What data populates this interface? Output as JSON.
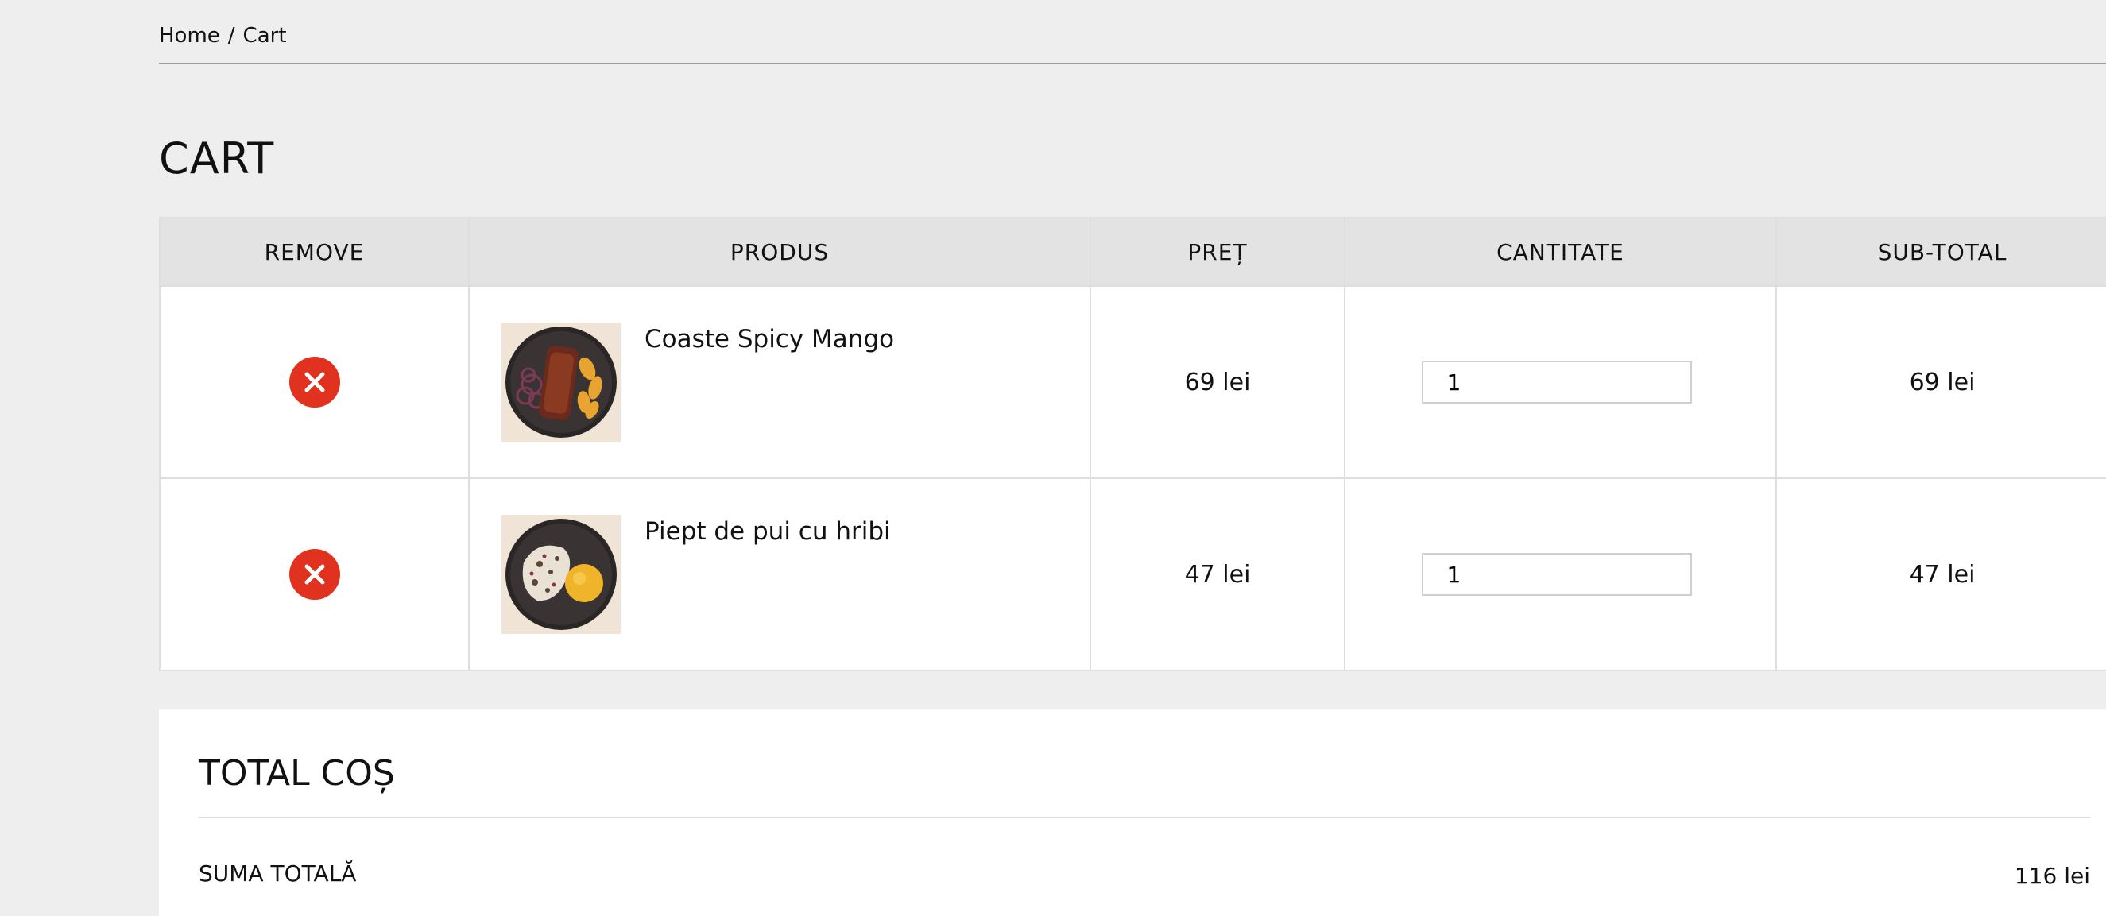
{
  "breadcrumb": {
    "home": "Home",
    "separator": "/",
    "current": "Cart"
  },
  "page_title": "CART",
  "table": {
    "headers": {
      "remove": "REMOVE",
      "product": "PRODUS",
      "price": "PREȚ",
      "quantity": "CANTITATE",
      "subtotal": "SUB-TOTAL"
    },
    "rows": [
      {
        "name": "Coaste Spicy Mango",
        "price": "69 lei",
        "quantity": "1",
        "subtotal": "69 lei"
      },
      {
        "name": "Piept de pui cu hribi",
        "price": "47 lei",
        "quantity": "1",
        "subtotal": "47 lei"
      }
    ]
  },
  "totals": {
    "title": "TOTAL COȘ",
    "label": "SUMA TOTALĂ",
    "value": "116 lei"
  },
  "colors": {
    "remove_button": "#e1321f",
    "background": "#eeeeee",
    "header_bg": "#e3e3e3"
  },
  "icons": {
    "remove": "close-circle-icon"
  }
}
